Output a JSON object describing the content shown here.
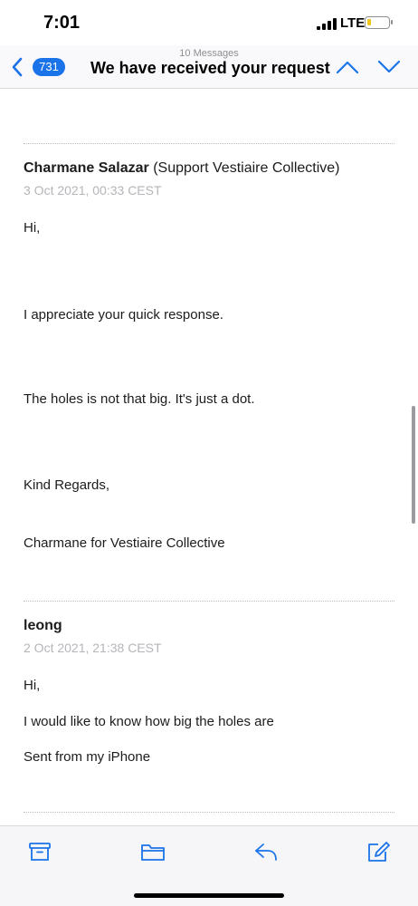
{
  "status_bar": {
    "time": "7:01",
    "network": "LTE",
    "battery_level": 0.2,
    "battery_color": "#f5c518"
  },
  "nav": {
    "unread_count": "731",
    "subtitle": "10 Messages",
    "title": "We have received your request",
    "icons": [
      "back-chevron-icon",
      "chevron-up-icon",
      "chevron-down-icon"
    ],
    "accent_color": "#1a73e8"
  },
  "messages": [
    {
      "sender_name": "Charmane Salazar",
      "sender_detail": "(Support Vestiaire Collective)",
      "date": "3 Oct 2021, 00:33 CEST",
      "lines": [
        "Hi,",
        "I appreciate your quick response.",
        "The holes is not that big. It's just a dot.",
        "Kind Regards,",
        "Charmane for Vestiaire Collective"
      ]
    },
    {
      "sender_name": "leong",
      "sender_detail": "",
      "date": "2 Oct 2021, 21:38 CEST",
      "lines": [
        "Hi,",
        "I would like to know how big the holes are",
        "Sent from my iPhone"
      ]
    }
  ],
  "toolbar": {
    "icons": [
      "archive-icon",
      "folder-icon",
      "reply-icon",
      "compose-icon"
    ]
  }
}
